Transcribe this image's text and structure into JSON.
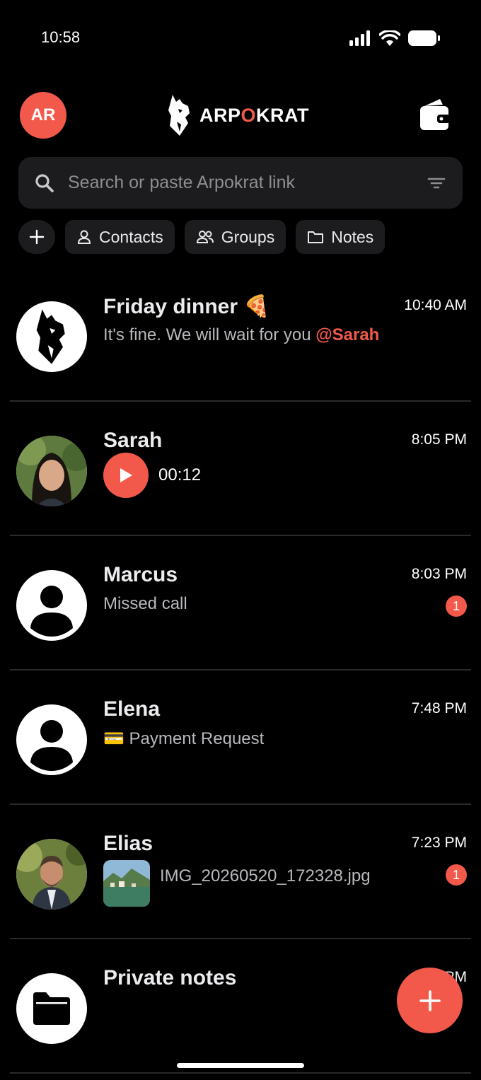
{
  "status_bar": {
    "time": "10:58"
  },
  "header": {
    "avatar_initials": "AR",
    "brand_prefix": "ARP",
    "brand_accent": "O",
    "brand_suffix": "KRAT",
    "accent_color": "#F2594B"
  },
  "search": {
    "placeholder": "Search or paste Arpokrat link"
  },
  "chips": {
    "add_icon": "plus-icon",
    "contacts_label": "Contacts",
    "groups_label": "Groups",
    "notes_label": "Notes"
  },
  "chats": [
    {
      "name": "Friday dinner 🍕",
      "time": "10:40 AM",
      "preview": "It's fine. We will wait for you ",
      "mention": "@Sarah",
      "avatar": "arpokrat-logo-icon"
    },
    {
      "name": "Sarah",
      "time": "8:05 PM",
      "voice_duration": "00:12",
      "avatar": "sarah-photo"
    },
    {
      "name": "Marcus",
      "time": "8:03 PM",
      "preview": "Missed call",
      "unread": "1",
      "avatar": "user-icon"
    },
    {
      "name": "Elena",
      "time": "7:48 PM",
      "preview": "💳 Payment Request",
      "avatar": "user-icon"
    },
    {
      "name": "Elias",
      "time": "7:23 PM",
      "preview": "IMG_20260520_172328.jpg",
      "unread": "1",
      "avatar": "elias-photo"
    },
    {
      "name": "Private notes",
      "time": "6:…PM",
      "avatar": "folder-icon"
    }
  ],
  "fab": {
    "icon": "plus-icon"
  }
}
